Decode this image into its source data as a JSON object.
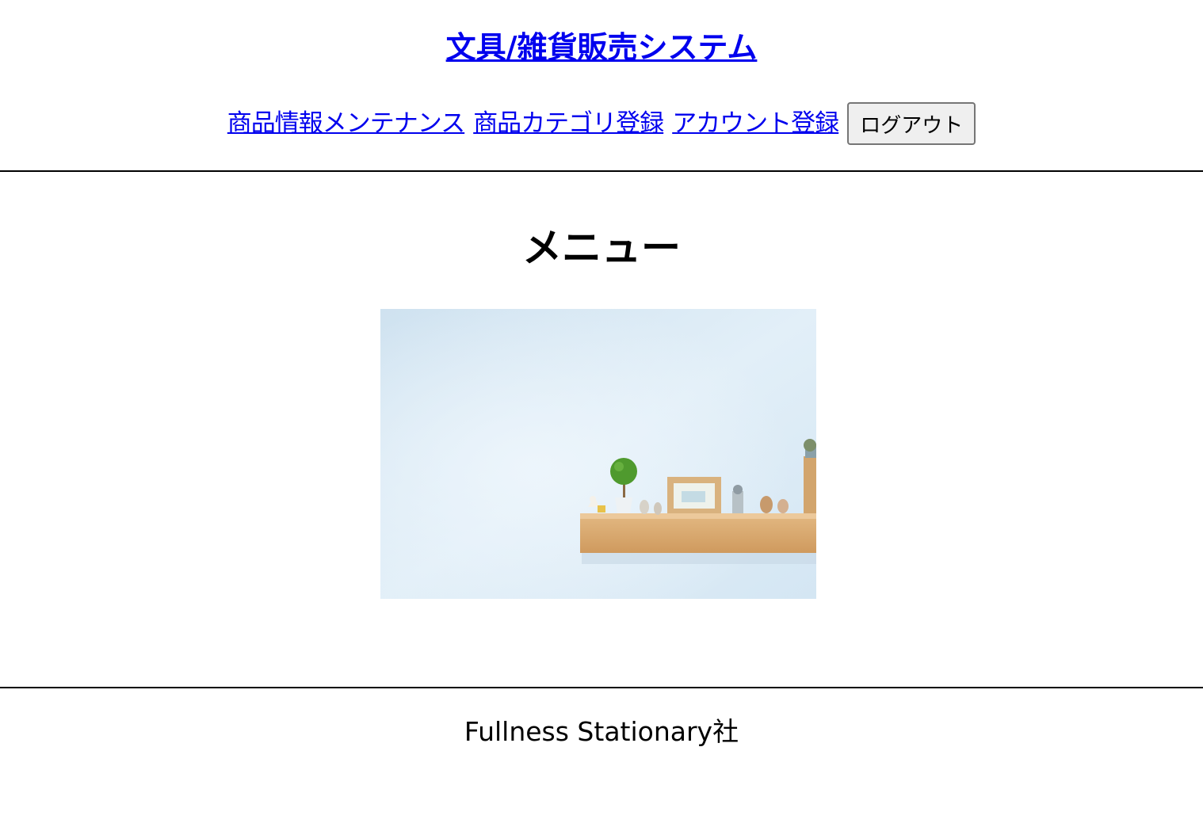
{
  "header": {
    "site_title": "文具/雑貨販売システム"
  },
  "nav": {
    "links": [
      {
        "label": "商品情報メンテナンス"
      },
      {
        "label": "商品カテゴリ登録"
      },
      {
        "label": "アカウント登録"
      }
    ],
    "logout_label": "ログアウト"
  },
  "main": {
    "heading": "メニュー",
    "hero_image": {
      "subject": "shelf-with-decorations-photo",
      "colors": {
        "wall": "#dbeaf5",
        "shelf": "#d9aa72",
        "tree": "#4f9a2e"
      }
    }
  },
  "footer": {
    "company": "Fullness Stationary社"
  },
  "colors": {
    "link": "#0000ee",
    "button_bg": "#efefef",
    "text": "#000000"
  }
}
